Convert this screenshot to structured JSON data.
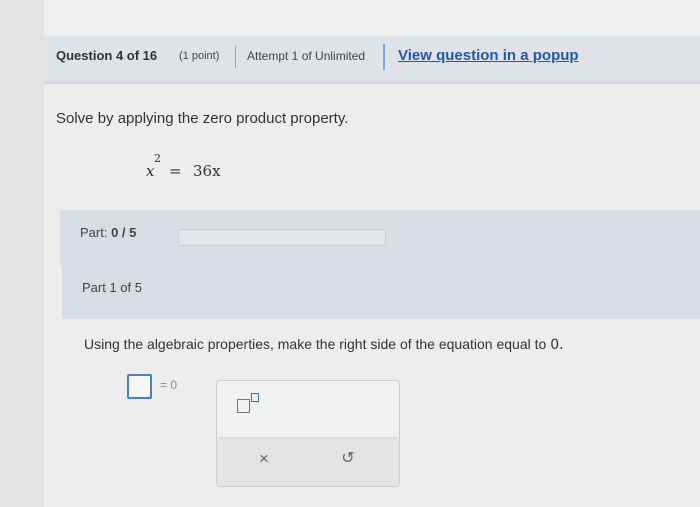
{
  "header": {
    "question_label": "Question 4 of 16",
    "points": "(1 point)",
    "attempt": "Attempt 1 of Unlimited",
    "popup_link": "View question in a popup"
  },
  "question": {
    "instruction": "Solve by applying the zero product property.",
    "equation": {
      "variable": "x",
      "exponent": "2",
      "equals": "=",
      "rhs": "36x"
    }
  },
  "progress": {
    "label": "Part:",
    "score": "0 / 5",
    "fraction": 0.0
  },
  "part": {
    "title": "Part 1 of 5",
    "instruction": "Using the algebraic properties, make the right side of the equation equal to",
    "instruction_value": "0.",
    "answer_value": "",
    "answer_rhs": "= 0"
  },
  "toolbox": {
    "exponent_icon": "superscript-template-icon",
    "clear_symbol": "×",
    "undo_symbol": "↺"
  },
  "colors": {
    "link": "#1f5aa8",
    "accent": "#4a7fc1",
    "header_bg": "#dfe3e8"
  }
}
